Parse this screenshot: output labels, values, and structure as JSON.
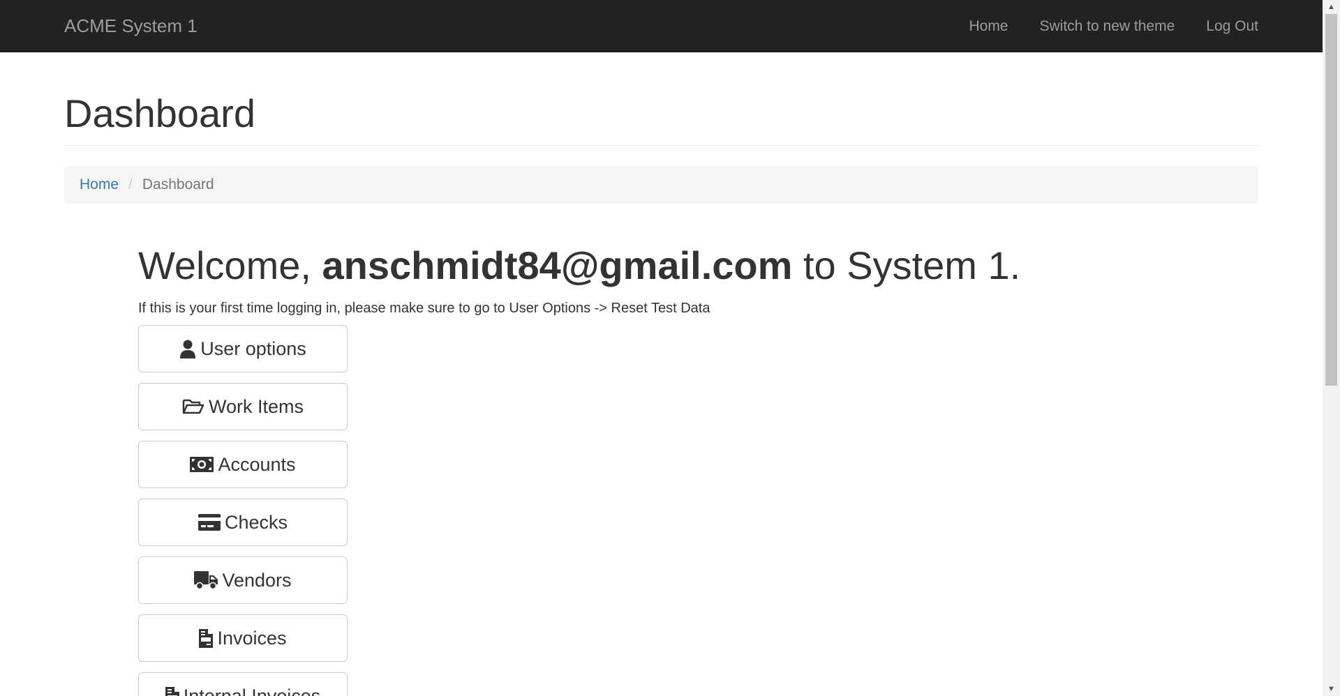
{
  "navbar": {
    "brand": "ACME System 1",
    "links": [
      {
        "label": "Home"
      },
      {
        "label": "Switch to new theme"
      },
      {
        "label": "Log Out"
      }
    ]
  },
  "page": {
    "title": "Dashboard"
  },
  "breadcrumb": {
    "home": "Home",
    "separator": "/",
    "current": "Dashboard"
  },
  "welcome": {
    "prefix": "Welcome, ",
    "email": "anschmidt84@gmail.com",
    "suffix": " to System 1."
  },
  "note": "If this is your first time logging in, please make sure to go to User Options -> Reset Test Data",
  "menu": [
    {
      "label": "User options",
      "icon": "user-icon"
    },
    {
      "label": "Work Items",
      "icon": "folder-open-icon"
    },
    {
      "label": "Accounts",
      "icon": "money-bill-icon"
    },
    {
      "label": "Checks",
      "icon": "credit-card-icon"
    },
    {
      "label": "Vendors",
      "icon": "truck-icon"
    },
    {
      "label": "Invoices",
      "icon": "file-invoice-icon"
    },
    {
      "label": "Internal Invoices",
      "icon": "file-invoice-icon"
    }
  ]
}
